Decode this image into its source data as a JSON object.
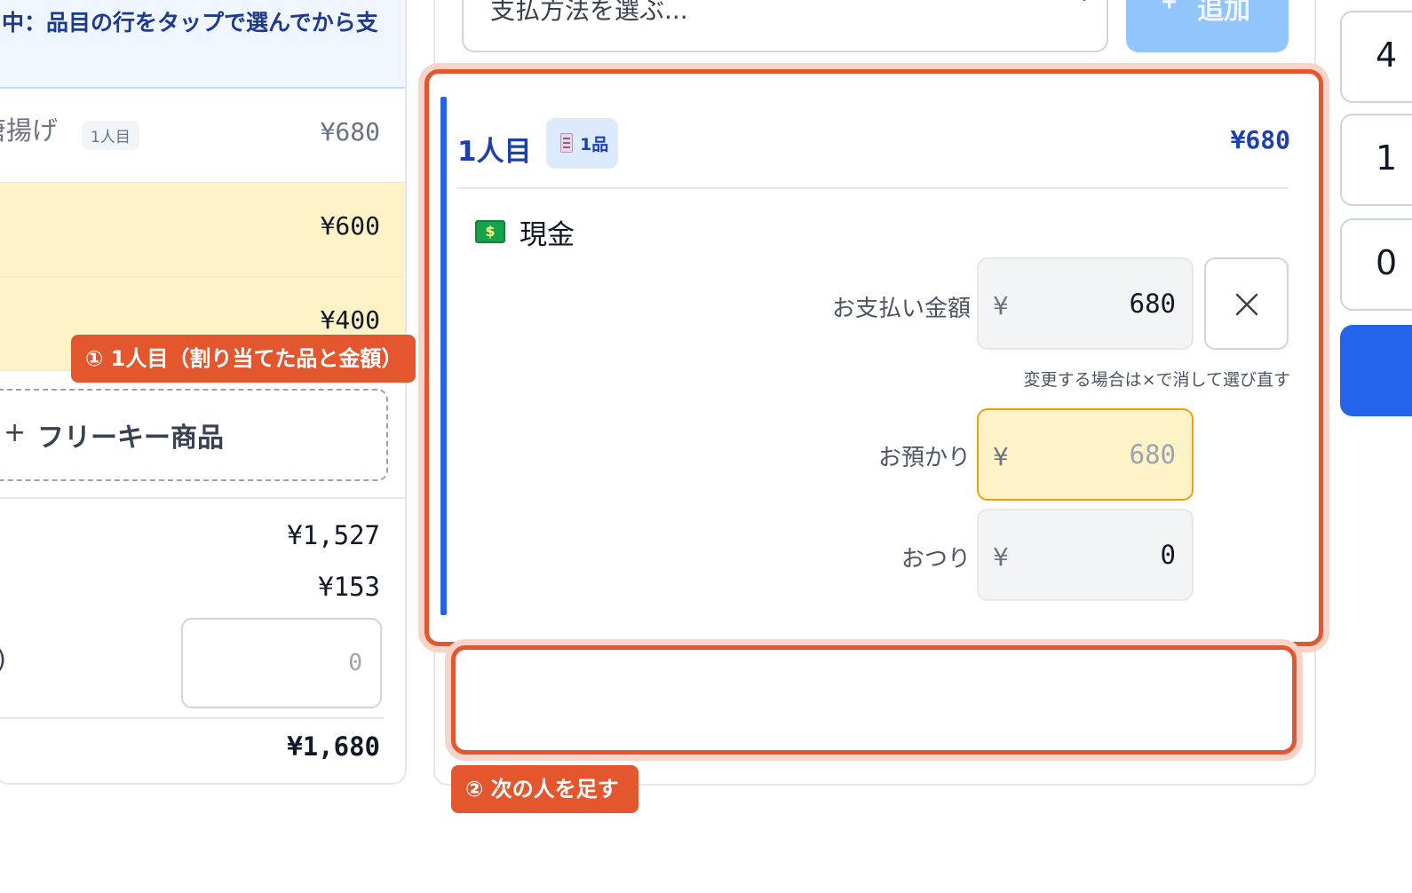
{
  "left_panel": {
    "split_banner_text": "中：品目の行をタップで選んでから支",
    "items": [
      {
        "name": "唐揚げ",
        "assigned_person": "1人目",
        "price": "¥680",
        "highlighted": false
      },
      {
        "name": "",
        "price": "¥600",
        "highlighted": true
      },
      {
        "name": "",
        "price": "¥400",
        "highlighted": true
      }
    ],
    "free_key_button": {
      "icon": "+",
      "label": "フリーキー商品"
    },
    "totals": {
      "subtotal": "¥1,527",
      "tax": "¥153",
      "partial_label": ")",
      "discount_placeholder": "0",
      "grand_total": "¥1,680"
    }
  },
  "payment": {
    "method_select_value": "支払方法を選ぶ...",
    "add_button": {
      "icon": "+",
      "label": "追加"
    }
  },
  "person_card": {
    "title": "1人目",
    "item_count_badge": "1品",
    "total": "¥680",
    "method": {
      "icon": "banknote-icon",
      "label": "現金"
    },
    "pay_amount": {
      "label": "お支払い金額",
      "currency": "¥",
      "value": "680"
    },
    "hint": "変更する場合は×で消して選び直す",
    "tendered": {
      "label": "お預かり",
      "currency": "¥",
      "placeholder": "680"
    },
    "change": {
      "label": "おつり",
      "currency": "¥",
      "value": "0"
    }
  },
  "callouts": {
    "person_card": "① 1人目（割り当てた品と金額）",
    "add_person": "② 次の人を足す"
  },
  "keypad": {
    "keys": [
      "4",
      "1",
      "0"
    ]
  },
  "colors": {
    "accent_blue": "#2563eb",
    "callout_orange": "#e4572e",
    "highlight_yellow": "#fef3c7"
  }
}
